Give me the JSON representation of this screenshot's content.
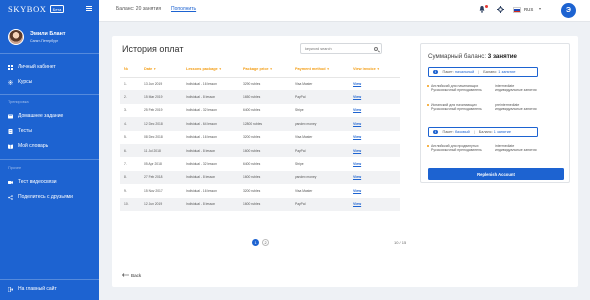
{
  "app": {
    "logo_text": "SKYBOX",
    "logo_badge": "Бета"
  },
  "user": {
    "name": "Эмили Блант",
    "city": "Санкт-Петербург",
    "initial": "Э"
  },
  "sidebar": {
    "items": [
      {
        "label": "Личный кабинет",
        "icon": "cabinet-icon"
      },
      {
        "label": "Курсы",
        "icon": "courses-icon"
      }
    ],
    "section_training": "Тренировка",
    "training_items": [
      {
        "label": "Домашнее задание",
        "icon": "homework-icon"
      },
      {
        "label": "Тесты",
        "icon": "tests-icon"
      },
      {
        "label": "Мой словарь",
        "icon": "dictionary-icon"
      }
    ],
    "section_other": "Прочее",
    "other_items": [
      {
        "label": "Тест видеосвязи",
        "icon": "video-icon"
      },
      {
        "label": "Поделитесь с друзьями",
        "icon": "share-icon"
      }
    ],
    "footer_link": "На главный сайт"
  },
  "topbar": {
    "balance": "Баланс: 20 занятия",
    "topup": "Пополнить",
    "language": "RUS"
  },
  "main": {
    "title": "История оплат",
    "search_placeholder": "keyword search",
    "columns": [
      "№",
      "Date",
      "Lessons package",
      "Package price",
      "Payment method",
      "View invoice"
    ],
    "rows": [
      {
        "n": "1.",
        "date": "13 Jun 2019",
        "package": "Individual - 16 lesson",
        "price": "3290 rubles",
        "method": "Visa Master",
        "view": "View"
      },
      {
        "n": "2.",
        "date": "15 Mar 2019",
        "package": "Individual - 8 lesson",
        "price": "1650 rubles",
        "method": "PayPal",
        "view": "View"
      },
      {
        "n": "3.",
        "date": "25 Feb 2019",
        "package": "Individual - 32 lesson",
        "price": "6400 rubles",
        "method": "Stripe",
        "view": "View"
      },
      {
        "n": "4.",
        "date": "12 Dec 2018",
        "package": "Individual - 64 lesson",
        "price": "12800 rubles",
        "method": "yandex money",
        "view": "View"
      },
      {
        "n": "5.",
        "date": "08 Dec 2018",
        "package": "Individual - 16 lesson",
        "price": "3200 rubles",
        "method": "Visa Master",
        "view": "View"
      },
      {
        "n": "6.",
        "date": "11 Jul 2018",
        "package": "Individual - 8 lesson",
        "price": "1600 rubles",
        "method": "PayPal",
        "view": "View"
      },
      {
        "n": "7.",
        "date": "05 Apr 2018",
        "package": "Individual - 32 lesson",
        "price": "6400 rubles",
        "method": "Stripe",
        "view": "View"
      },
      {
        "n": "8.",
        "date": "27 Feb 2018",
        "package": "Individual - 8 lesson",
        "price": "1600 rubles",
        "method": "yandex money",
        "view": "View"
      },
      {
        "n": "9.",
        "date": "15 Nov 2017",
        "package": "Individual - 16 lesson",
        "price": "3200 rubles",
        "method": "Visa Master",
        "view": "View"
      },
      {
        "n": "10.",
        "date": "12 Jun 2019",
        "package": "Individual - 8 lesson",
        "price": "1600 rubles",
        "method": "PayPal",
        "view": "View"
      }
    ],
    "pages": [
      "1",
      "2"
    ],
    "page_count": "10 / 15",
    "back": "Back"
  },
  "summary": {
    "title_prefix": "Суммарный баланс:",
    "title_value": "3 занятие",
    "packages": [
      {
        "name_prefix": "Пакет:",
        "name": "начальный",
        "balance_prefix": "Баланс:",
        "balance": "1 занятие",
        "courses": [
          {
            "name": "Английский для начинающих",
            "mode": "intermediate",
            "teacher": "Русскоязычный преподаватель",
            "lesson": "индивидуальные занятия"
          },
          {
            "name": "Испанский для начинающих",
            "mode": "preintermediate",
            "teacher": "Русскоязычный преподаватель",
            "lesson": "индивидуальные занятия"
          }
        ]
      },
      {
        "name_prefix": "Пакет:",
        "name": "базовый",
        "balance_prefix": "Баланс:",
        "balance": "1 занятие",
        "courses": [
          {
            "name": "Английский для продвинутых",
            "mode": "intermediate",
            "teacher": "Русскоязычный преподаватель",
            "lesson": "индивидуальные занятия"
          }
        ]
      }
    ],
    "button": "Replenish Account"
  }
}
